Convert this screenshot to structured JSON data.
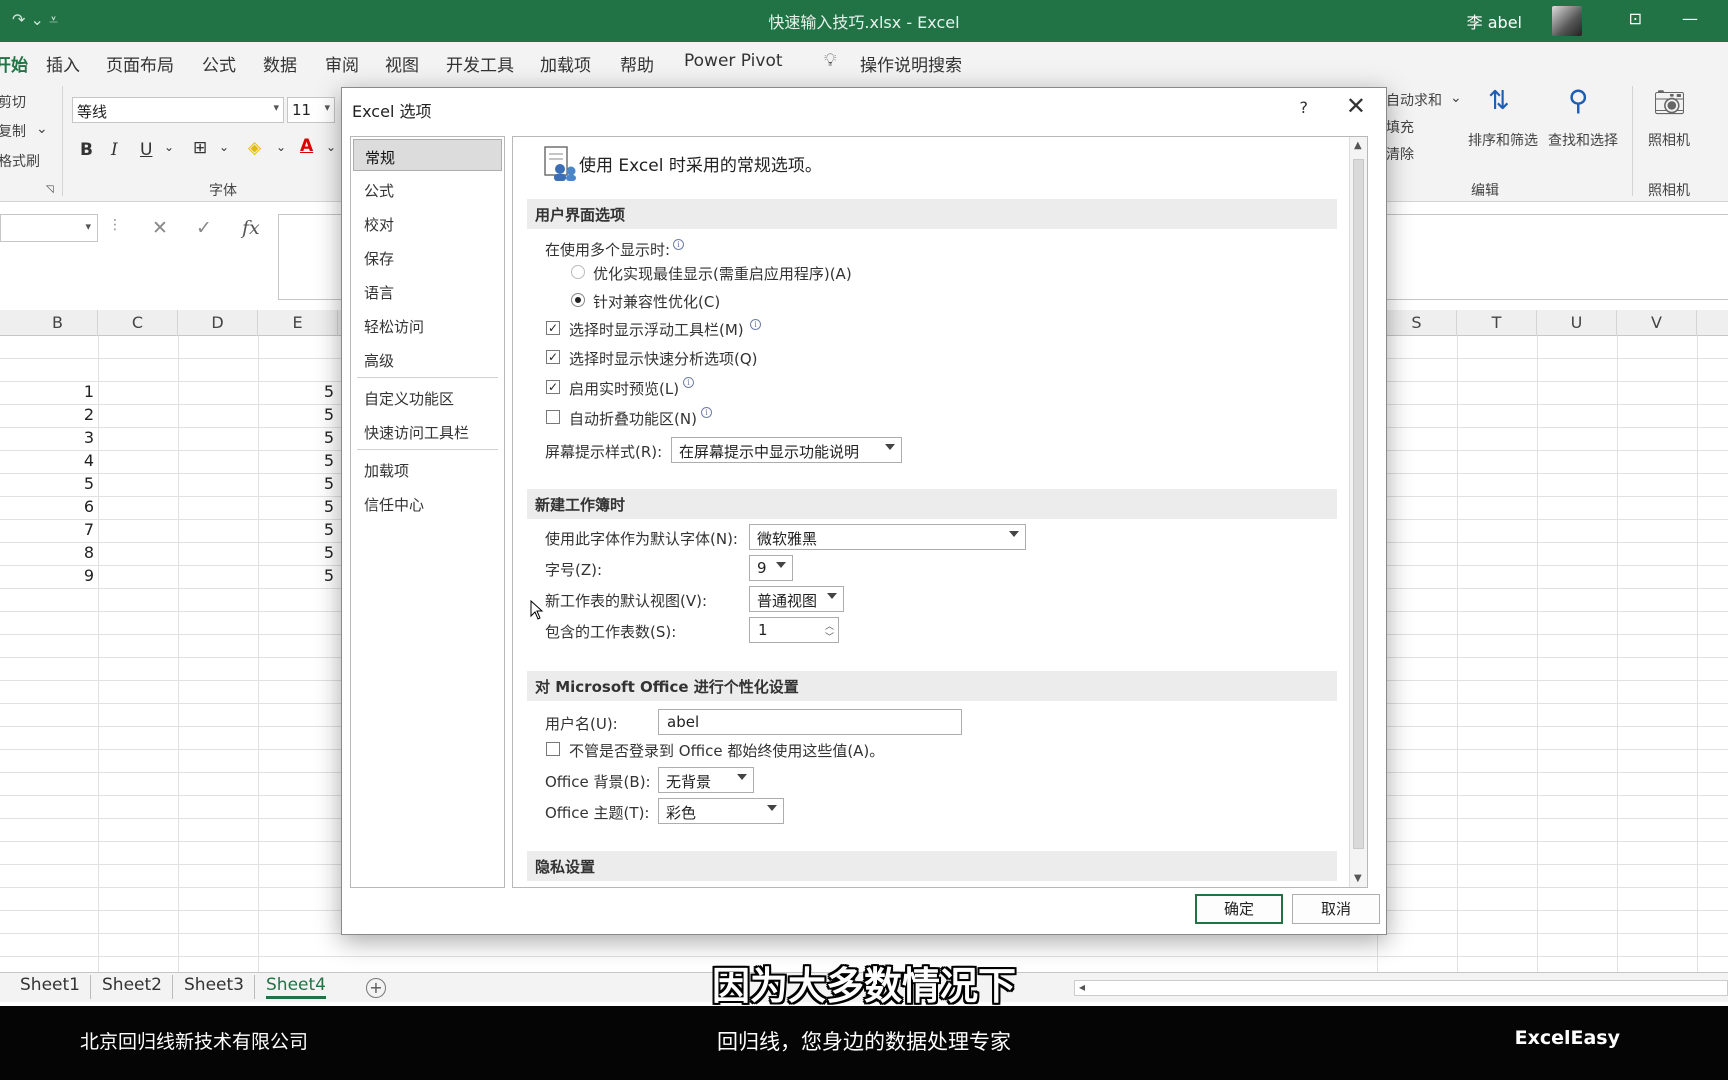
{
  "titlebar": {
    "qat": "↷ ⌄   ⩡",
    "title": "快速输入技巧.xlsx  -  Excel",
    "user": "李 abel",
    "ribbon_display_icon": "ribbon-display-icon",
    "minimize_icon": "minimize-icon"
  },
  "tabs": [
    {
      "label": "开始"
    },
    {
      "label": "插入"
    },
    {
      "label": "页面布局"
    },
    {
      "label": "公式"
    },
    {
      "label": "数据"
    },
    {
      "label": "审阅"
    },
    {
      "label": "视图"
    },
    {
      "label": "开发工具"
    },
    {
      "label": "加载项"
    },
    {
      "label": "帮助"
    },
    {
      "label": "Power Pivot"
    },
    {
      "label": "操作说明搜索"
    }
  ],
  "ribbon": {
    "clipboard": {
      "cut": "剪切",
      "copy": "复制",
      "format_painter": "格式刷"
    },
    "font_name": "等线",
    "font_size": "11",
    "font_group": "字体",
    "editing": {
      "autosum": "自动求和",
      "fill": "填充",
      "clear": "清除",
      "sort_filter": "排序和筛选",
      "find_select": "查找和选择",
      "group": "编辑"
    },
    "camera": {
      "label": "照相机",
      "group": "照相机"
    }
  },
  "grid": {
    "columns_left": [
      "B",
      "C",
      "D",
      "E"
    ],
    "columns_right": [
      "S",
      "T",
      "U",
      "V"
    ],
    "col_b_values": [
      "1",
      "2",
      "3",
      "4",
      "5",
      "6",
      "7",
      "8",
      "9"
    ],
    "col_e_values": [
      "5",
      "5",
      "5",
      "5",
      "5",
      "5",
      "5",
      "5",
      "5"
    ]
  },
  "sheets": [
    {
      "label": "Sheet1"
    },
    {
      "label": "Sheet2"
    },
    {
      "label": "Sheet3"
    },
    {
      "label": "Sheet4",
      "active": true
    }
  ],
  "caption": "因为大多数情况下",
  "banner": {
    "left": "北京回归线新技术有限公司",
    "center": "回归线，您身边的数据处理专家",
    "right": "ExcelEasy"
  },
  "dialog": {
    "title": "Excel 选项",
    "help": "?",
    "nav": [
      {
        "label": "常规",
        "selected": true
      },
      {
        "label": "公式"
      },
      {
        "label": "校对"
      },
      {
        "label": "保存"
      },
      {
        "label": "语言"
      },
      {
        "label": "轻松访问"
      },
      {
        "label": "高级"
      },
      {
        "label": "自定义功能区"
      },
      {
        "label": "快速访问工具栏"
      },
      {
        "label": "加载项"
      },
      {
        "label": "信任中心"
      }
    ],
    "hero": "使用 Excel 时采用的常规选项。",
    "ui_section": {
      "heading": "用户界面选项",
      "multi_display": "在使用多个显示时:",
      "radio_best": "优化实现最佳显示(需重启应用程序)(A)",
      "radio_compat": "针对兼容性优化(C)",
      "mini_toolbar": "选择时显示浮动工具栏(M)",
      "quick_analysis": "选择时显示快速分析选项(Q)",
      "live_preview": "启用实时预览(L)",
      "collapse_ribbon": "自动折叠功能区(N)",
      "screentip_label": "屏幕提示样式(R):",
      "screentip_value": "在屏幕提示中显示功能说明"
    },
    "new_wb_section": {
      "heading": "新建工作簿时",
      "font_label": "使用此字体作为默认字体(N):",
      "font_value": "微软雅黑",
      "size_label": "字号(Z):",
      "size_value": "9",
      "view_label": "新工作表的默认视图(V):",
      "view_value": "普通视图",
      "sheets_label": "包含的工作表数(S):",
      "sheets_value": "1"
    },
    "personal_section": {
      "heading": "对 Microsoft Office 进行个性化设置",
      "username_label": "用户名(U):",
      "username_value": "abel",
      "always_use": "不管是否登录到 Office 都始终使用这些值(A)。",
      "bg_label": "Office 背景(B):",
      "bg_value": "无背景",
      "theme_label": "Office 主题(T):",
      "theme_value": "彩色"
    },
    "privacy_section": {
      "heading": "隐私设置"
    },
    "ok": "确定",
    "cancel": "取消"
  }
}
